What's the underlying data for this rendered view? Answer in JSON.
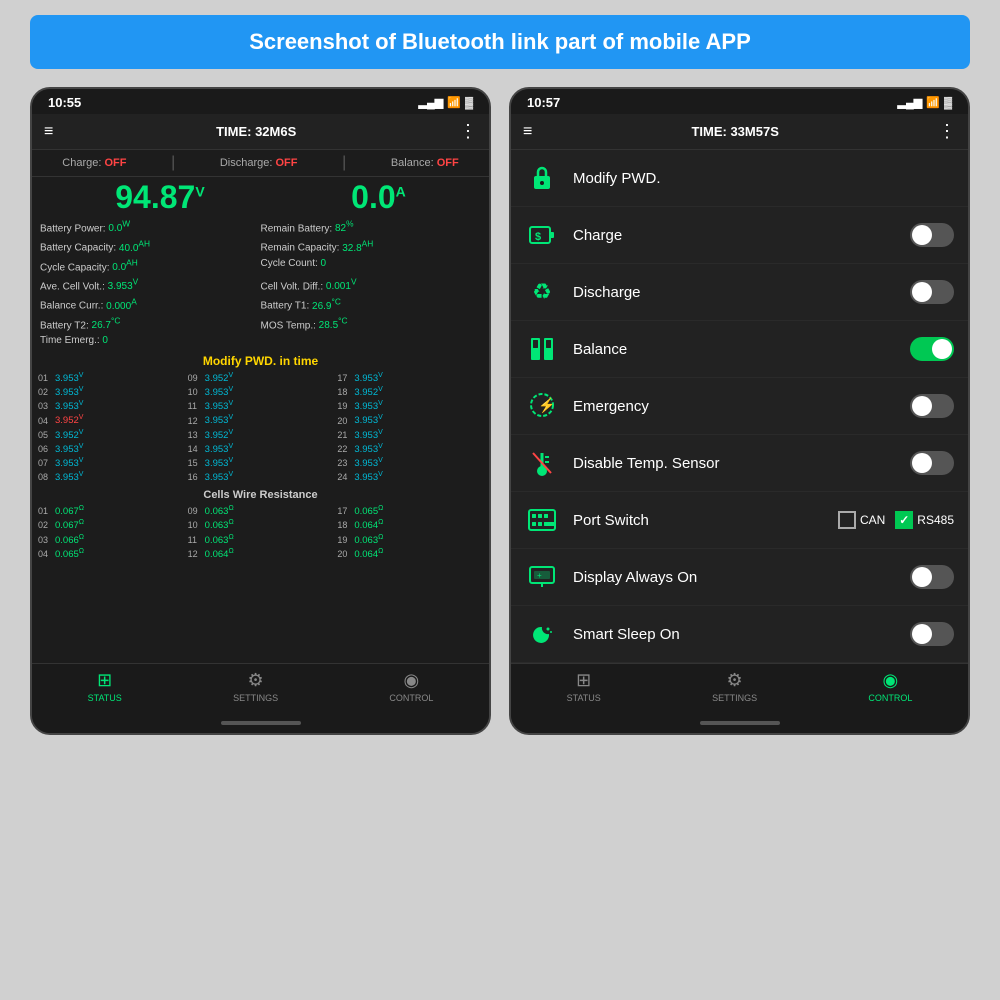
{
  "page": {
    "header": "Screenshot of Bluetooth link part of mobile APP"
  },
  "left_phone": {
    "status_bar": {
      "time": "10:55",
      "signal": "▂▄▆",
      "wifi": "WiFi",
      "battery": "🔋"
    },
    "header": {
      "menu": "≡",
      "time_label": "TIME: 32M6S",
      "dots": "⋮"
    },
    "status_items": [
      {
        "label": "Charge:",
        "value": "OFF"
      },
      {
        "label": "Discharge:",
        "value": "OFF"
      },
      {
        "label": "Balance:",
        "value": "OFF"
      }
    ],
    "big_voltage": "94.87",
    "big_voltage_unit": "V",
    "big_current": "0.0",
    "big_current_unit": "A",
    "metrics_left": [
      {
        "label": "Battery Power:",
        "value": "0.0",
        "unit": "W"
      },
      {
        "label": "Battery Capacity:",
        "value": "40.0",
        "unit": "AH"
      },
      {
        "label": "Cycle Capacity:",
        "value": "0.0",
        "unit": "AH"
      },
      {
        "label": "Ave. Cell Volt.:",
        "value": "3.953",
        "unit": "V"
      },
      {
        "label": "Balance Curr.:",
        "value": "0.000",
        "unit": "A"
      },
      {
        "label": "Battery T2:",
        "value": "26.7",
        "unit": "°C"
      },
      {
        "label": "Time Emerg.:",
        "value": "0"
      }
    ],
    "metrics_right": [
      {
        "label": "Remain Battery:",
        "value": "82",
        "unit": "%"
      },
      {
        "label": "Remain Capacity:",
        "value": "32.8",
        "unit": "AH"
      },
      {
        "label": "Cycle Count:",
        "value": "0"
      },
      {
        "label": "Cell Volt. Diff.:",
        "value": "0.001",
        "unit": "V"
      },
      {
        "label": "Battery T1:",
        "value": "26.9",
        "unit": "°C"
      },
      {
        "label": "MOS Temp.:",
        "value": "28.5",
        "unit": "°C"
      }
    ],
    "modify_pwd_banner": "Modify PWD. in time",
    "cells": [
      {
        "num": "01",
        "val": "3.953",
        "unit": "V",
        "color": "blue"
      },
      {
        "num": "09",
        "val": "3.952",
        "unit": "V",
        "color": "blue"
      },
      {
        "num": "17",
        "val": "3.953",
        "unit": "V",
        "color": "blue"
      },
      {
        "num": "02",
        "val": "3.953",
        "unit": "V",
        "color": "blue"
      },
      {
        "num": "10",
        "val": "3.953",
        "unit": "V",
        "color": "blue"
      },
      {
        "num": "18",
        "val": "3.952",
        "unit": "V",
        "color": "blue"
      },
      {
        "num": "03",
        "val": "3.953",
        "unit": "V",
        "color": "blue"
      },
      {
        "num": "11",
        "val": "3.953",
        "unit": "V",
        "color": "blue"
      },
      {
        "num": "19",
        "val": "3.953",
        "unit": "V",
        "color": "blue"
      },
      {
        "num": "04",
        "val": "3.952",
        "unit": "V",
        "color": "red"
      },
      {
        "num": "12",
        "val": "3.953",
        "unit": "V",
        "color": "blue"
      },
      {
        "num": "20",
        "val": "3.953",
        "unit": "V",
        "color": "blue"
      },
      {
        "num": "05",
        "val": "3.952",
        "unit": "V",
        "color": "blue"
      },
      {
        "num": "13",
        "val": "3.952",
        "unit": "V",
        "color": "blue"
      },
      {
        "num": "21",
        "val": "3.953",
        "unit": "V",
        "color": "blue"
      },
      {
        "num": "06",
        "val": "3.953",
        "unit": "V",
        "color": "blue"
      },
      {
        "num": "14",
        "val": "3.953",
        "unit": "V",
        "color": "blue"
      },
      {
        "num": "22",
        "val": "3.953",
        "unit": "V",
        "color": "blue"
      },
      {
        "num": "07",
        "val": "3.953",
        "unit": "V",
        "color": "blue"
      },
      {
        "num": "15",
        "val": "3.953",
        "unit": "V",
        "color": "blue"
      },
      {
        "num": "23",
        "val": "3.953",
        "unit": "V",
        "color": "blue"
      },
      {
        "num": "08",
        "val": "3.953",
        "unit": "V",
        "color": "blue"
      },
      {
        "num": "16",
        "val": "3.953",
        "unit": "V",
        "color": "blue"
      },
      {
        "num": "24",
        "val": "3.953",
        "unit": "V",
        "color": "blue"
      }
    ],
    "resistance_title": "Cells Wire Resistance",
    "resistances": [
      {
        "num": "01",
        "val": "0.067",
        "unit": "Ω"
      },
      {
        "num": "09",
        "val": "0.063",
        "unit": "Ω"
      },
      {
        "num": "17",
        "val": "0.065",
        "unit": "Ω"
      },
      {
        "num": "02",
        "val": "0.067",
        "unit": "Ω"
      },
      {
        "num": "10",
        "val": "0.063",
        "unit": "Ω"
      },
      {
        "num": "18",
        "val": "0.064",
        "unit": "Ω"
      },
      {
        "num": "03",
        "val": "0.066",
        "unit": "Ω"
      },
      {
        "num": "11",
        "val": "0.063",
        "unit": "Ω"
      },
      {
        "num": "19",
        "val": "0.063",
        "unit": "Ω"
      },
      {
        "num": "04",
        "val": "0.065",
        "unit": "Ω"
      },
      {
        "num": "12",
        "val": "0.064",
        "unit": "Ω"
      },
      {
        "num": "20",
        "val": "0.064",
        "unit": "Ω"
      }
    ],
    "nav": [
      {
        "icon": "⊞",
        "label": "STATUS",
        "active": true
      },
      {
        "icon": "⚙",
        "label": "SETTINGS",
        "active": false
      },
      {
        "icon": "◉",
        "label": "CONTROL",
        "active": false
      }
    ]
  },
  "right_phone": {
    "status_bar": {
      "time": "10:57"
    },
    "header": {
      "menu": "≡",
      "time_label": "TIME: 33M57S",
      "dots": "⋮"
    },
    "controls": [
      {
        "id": "modify-pwd",
        "icon": "🔒",
        "label": "Modify PWD.",
        "toggle": null
      },
      {
        "id": "charge",
        "icon": "🔋",
        "label": "Charge",
        "toggle": "off"
      },
      {
        "id": "discharge",
        "icon": "♻",
        "label": "Discharge",
        "toggle": "off"
      },
      {
        "id": "balance",
        "icon": "🔋",
        "label": "Balance",
        "toggle": "on"
      },
      {
        "id": "emergency",
        "icon": "⚡",
        "label": "Emergency",
        "toggle": "off"
      },
      {
        "id": "disable-temp",
        "icon": "🌡",
        "label": "Disable Temp. Sensor",
        "toggle": "off"
      },
      {
        "id": "port-switch",
        "icon": "⌨",
        "label": "Port Switch",
        "toggle": null,
        "port_options": [
          {
            "id": "can",
            "label": "CAN",
            "checked": false
          },
          {
            "id": "rs485",
            "label": "RS485",
            "checked": true
          }
        ]
      },
      {
        "id": "display-always",
        "icon": "🖥",
        "label": "Display Always On",
        "toggle": "off"
      },
      {
        "id": "smart-sleep",
        "icon": "🌙",
        "label": "Smart Sleep On",
        "toggle": "off"
      }
    ],
    "nav": [
      {
        "icon": "⊞",
        "label": "STATUS",
        "active": false
      },
      {
        "icon": "⚙",
        "label": "SETTINGS",
        "active": false
      },
      {
        "icon": "◉",
        "label": "CONTROL",
        "active": true
      }
    ]
  }
}
